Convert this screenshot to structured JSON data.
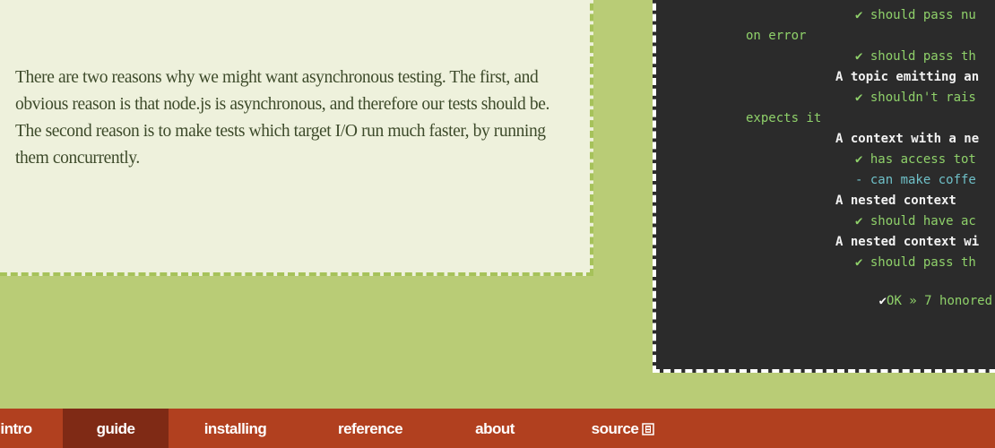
{
  "prose": {
    "heading_fragment": "— ·",
    "paragraph": "There are two reasons why we might want asynchronous testing. The first, and obvious reason is that node.js is asynchronous, and therefore our tests should be. The second reason is to make tests which target I/O run much faster, by running them concurrently."
  },
  "terminal": {
    "lines": [
      {
        "text": "✔ should pass nu",
        "color": "green"
      },
      {
        "text": "on error",
        "color": "green"
      },
      {
        "text": "✔ should pass th",
        "color": "green"
      },
      {
        "text": "A topic emitting an",
        "color": "white"
      },
      {
        "text": "✔ shouldn't rais",
        "color": "green"
      },
      {
        "text": "expects it",
        "color": "green"
      },
      {
        "text": "A context with a ne",
        "color": "white"
      },
      {
        "text": "✔ has access tot",
        "color": "green"
      },
      {
        "text": "- can make coffe",
        "color": "cyan"
      },
      {
        "text": "A nested context",
        "color": "white"
      },
      {
        "text": "✔ should have ac",
        "color": "green"
      },
      {
        "text": "A nested context wi",
        "color": "white"
      },
      {
        "text": "✔ should pass th",
        "color": "green"
      },
      {
        "text": "OK » 7 honored -",
        "color": "ok"
      }
    ],
    "ok_mark": "✔"
  },
  "nav": {
    "items": [
      {
        "label": "intro"
      },
      {
        "label": "guide",
        "active": true
      },
      {
        "label": "installing"
      },
      {
        "label": "reference"
      },
      {
        "label": "about"
      },
      {
        "label": "source"
      }
    ]
  },
  "colors": {
    "page_bg": "#b9cc76",
    "panel_bg": "#eef1dc",
    "terminal_bg": "#2b2b2b",
    "nav_bg": "#b1401f",
    "nav_active_bg": "#7f2a15",
    "term_green": "#8fd16a"
  },
  "icons": {
    "source_link": "external-link-icon",
    "check": "check-icon"
  }
}
